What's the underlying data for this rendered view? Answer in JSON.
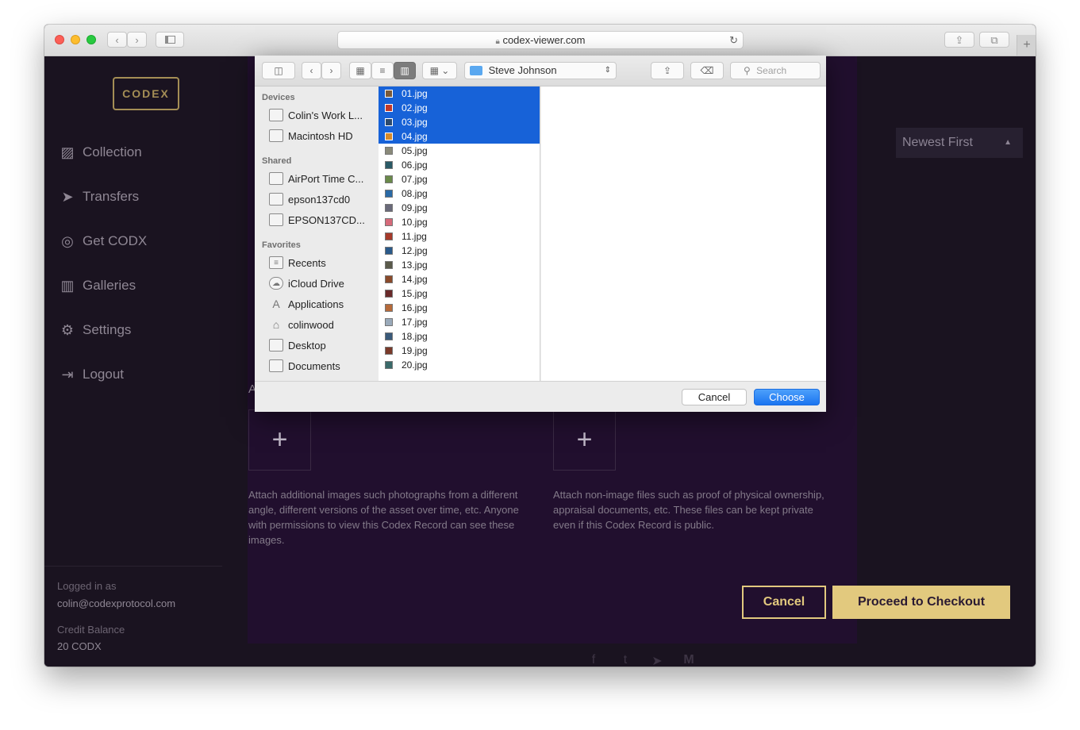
{
  "browser": {
    "url": "codex-viewer.com"
  },
  "app": {
    "logo_text": "CODEX",
    "nav": [
      {
        "label": "Collection"
      },
      {
        "label": "Transfers"
      },
      {
        "label": "Get CODX"
      },
      {
        "label": "Galleries"
      },
      {
        "label": "Settings"
      },
      {
        "label": "Logout"
      }
    ],
    "account": {
      "logged_in_label": "Logged in as",
      "email": "colin@codexprotocol.com",
      "credit_label": "Credit Balance",
      "credit_value": "20 CODX"
    },
    "sort_select": "Newest First",
    "section_initial": "A",
    "images_desc": "Attach additional images such photographs from a different angle, different versions of the asset over time, etc. Anyone with permissions to view this Codex Record can see these images.",
    "files_desc": "Attach non-image files such as proof of physical ownership, appraisal documents, etc. These files can be kept private even if this Codex Record is public.",
    "cancel_label": "Cancel",
    "checkout_label": "Proceed to Checkout"
  },
  "dialog": {
    "path": "Steve Johnson",
    "search_placeholder": "Search",
    "sidebar": {
      "devices_heading": "Devices",
      "devices": [
        "Colin's Work L...",
        "Macintosh HD"
      ],
      "shared_heading": "Shared",
      "shared": [
        "AirPort Time C...",
        "epson137cd0",
        "EPSON137CD..."
      ],
      "favorites_heading": "Favorites",
      "favorites": [
        "Recents",
        "iCloud Drive",
        "Applications",
        "colinwood",
        "Desktop",
        "Documents"
      ]
    },
    "files": [
      {
        "name": "01.jpg",
        "selected": true,
        "color": "#7a5a3a"
      },
      {
        "name": "02.jpg",
        "selected": true,
        "color": "#c0392b"
      },
      {
        "name": "03.jpg",
        "selected": true,
        "color": "#2c4a6e"
      },
      {
        "name": "04.jpg",
        "selected": true,
        "color": "#d68a2a"
      },
      {
        "name": "05.jpg",
        "selected": false,
        "color": "#8a8a7a"
      },
      {
        "name": "06.jpg",
        "selected": false,
        "color": "#2a5a66"
      },
      {
        "name": "07.jpg",
        "selected": false,
        "color": "#6a8a4a"
      },
      {
        "name": "08.jpg",
        "selected": false,
        "color": "#2a6aa6"
      },
      {
        "name": "09.jpg",
        "selected": false,
        "color": "#6a6a7a"
      },
      {
        "name": "10.jpg",
        "selected": false,
        "color": "#d66a7a"
      },
      {
        "name": "11.jpg",
        "selected": false,
        "color": "#a63a2a"
      },
      {
        "name": "12.jpg",
        "selected": false,
        "color": "#2a5a8a"
      },
      {
        "name": "13.jpg",
        "selected": false,
        "color": "#5a5a4a"
      },
      {
        "name": "14.jpg",
        "selected": false,
        "color": "#8a4a2a"
      },
      {
        "name": "15.jpg",
        "selected": false,
        "color": "#6a2a2a"
      },
      {
        "name": "16.jpg",
        "selected": false,
        "color": "#b66a3a"
      },
      {
        "name": "17.jpg",
        "selected": false,
        "color": "#9aaaba"
      },
      {
        "name": "18.jpg",
        "selected": false,
        "color": "#3a5a7a"
      },
      {
        "name": "19.jpg",
        "selected": false,
        "color": "#7a3a2a"
      },
      {
        "name": "20.jpg",
        "selected": false,
        "color": "#3a6a6a"
      }
    ],
    "cancel_label": "Cancel",
    "choose_label": "Choose"
  },
  "colors": {
    "accent_gold": "#e2c97e",
    "selection_blue": "#1762d8",
    "choose_blue": "#1a74f0"
  }
}
